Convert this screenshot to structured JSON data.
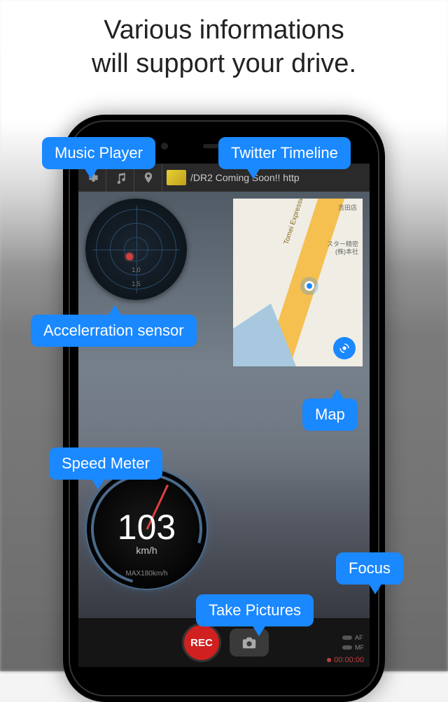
{
  "headline_line1": "Various informations",
  "headline_line2": "will support your drive.",
  "callouts": {
    "music": "Music Player",
    "twitter": "Twitter Timeline",
    "accel": "Accelerration sensor",
    "map": "Map",
    "speed": "Speed Meter",
    "focus": "Focus",
    "pics": "Take Pictures"
  },
  "ticker": "/DR2 Coming Soon!! http",
  "accel": {
    "ring1": "1.0",
    "ring2": "1.5"
  },
  "map_labels": {
    "top_right": "吉田店",
    "right": "スター精密 (株)本社",
    "road": "Tomei Expressway (Toll road)"
  },
  "speedo": {
    "value": "103",
    "unit": "km/h",
    "max": "MAX180km/h"
  },
  "rec_label": "REC",
  "focus": {
    "af": "AF",
    "mf": "MF"
  },
  "timer": "00:00:00",
  "colors": {
    "accent": "#1a88ff",
    "rec": "#d02020"
  }
}
